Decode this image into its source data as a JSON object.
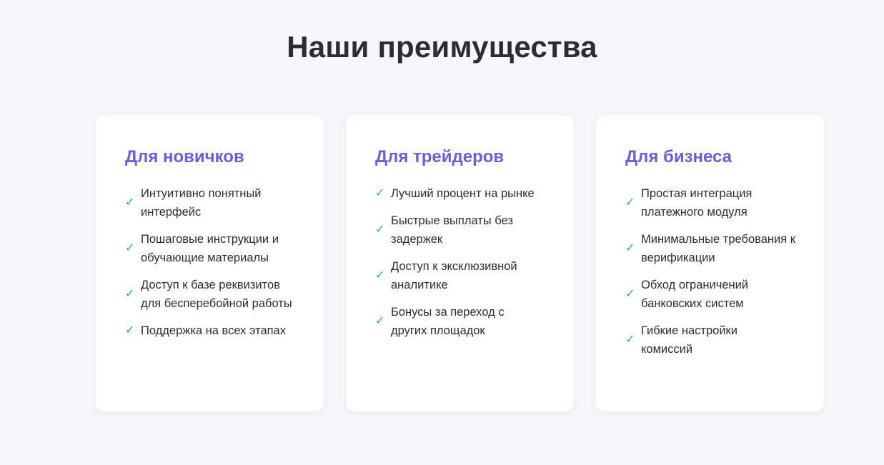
{
  "section": {
    "title": "Наши преимущества"
  },
  "cards": [
    {
      "title": "Для новичков",
      "items": [
        "Интуитивно понятный интерфейс",
        "Пошаговые инструкции и обучающие материалы",
        "Доступ к базе реквизитов для бесперебойной работы",
        "Поддержка на всех этапах"
      ]
    },
    {
      "title": "Для трейдеров",
      "items": [
        "Лучший процент на рынке",
        "Быстрые выплаты без задержек",
        "Доступ к эксклюзивной аналитике",
        "Бонусы за переход с других площадок"
      ]
    },
    {
      "title": "Для бизнеса",
      "items": [
        "Простая интеграция платежного модуля",
        "Минимальные требования к верификации",
        "Обход ограничений банковских систем",
        "Гибкие настройки комиссий"
      ]
    }
  ],
  "icons": {
    "check": "check-icon",
    "check_glyph": "✓"
  },
  "colors": {
    "background": "#f5f6fa",
    "card_title": "#6c5ce0",
    "check": "#1eb38a",
    "text": "#2b2e33"
  }
}
